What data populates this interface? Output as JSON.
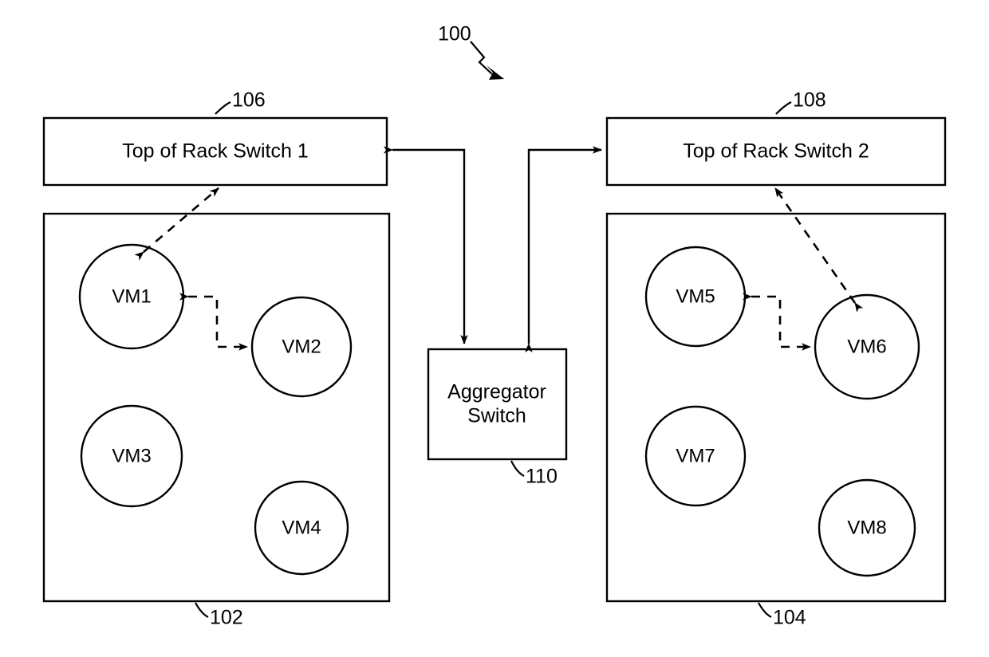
{
  "figure": {
    "reference_numeral": "100",
    "racks": [
      {
        "id": "rack-left",
        "reference_numeral": "102",
        "vms": [
          {
            "label": "VM1"
          },
          {
            "label": "VM2"
          },
          {
            "label": "VM3"
          },
          {
            "label": "VM4"
          }
        ]
      },
      {
        "id": "rack-right",
        "reference_numeral": "104",
        "vms": [
          {
            "label": "VM5"
          },
          {
            "label": "VM6"
          },
          {
            "label": "VM7"
          },
          {
            "label": "VM8"
          }
        ]
      }
    ],
    "switches": [
      {
        "id": "tor-switch-1",
        "label": "Top of Rack Switch 1",
        "reference_numeral": "106"
      },
      {
        "id": "tor-switch-2",
        "label": "Top of Rack Switch 2",
        "reference_numeral": "108"
      }
    ],
    "aggregator": {
      "id": "aggregator-switch",
      "label_line1": "Aggregator",
      "label_line2": "Switch",
      "reference_numeral": "110"
    },
    "colors": {
      "stroke": "#000000",
      "fill": "#ffffff"
    }
  }
}
